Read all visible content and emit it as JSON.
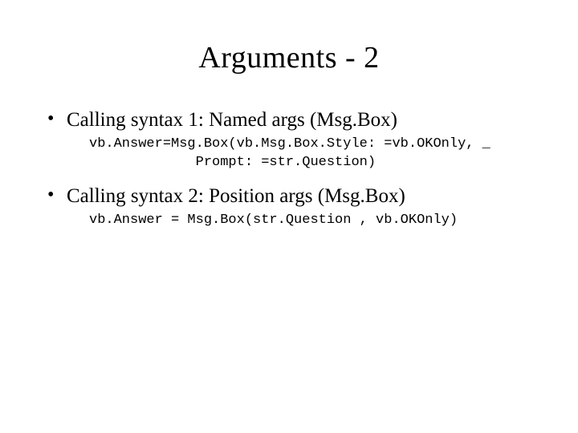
{
  "title": "Arguments - 2",
  "bullets": [
    {
      "text": "Calling syntax 1: Named args (Msg.Box)",
      "code": "vb.Answer=Msg.Box(vb.Msg.Box.Style: =vb.OKOnly, _\n             Prompt: =str.Question)"
    },
    {
      "text": "Calling syntax 2: Position args (Msg.Box)",
      "code": "vb.Answer = Msg.Box(str.Question , vb.OKOnly)"
    }
  ]
}
